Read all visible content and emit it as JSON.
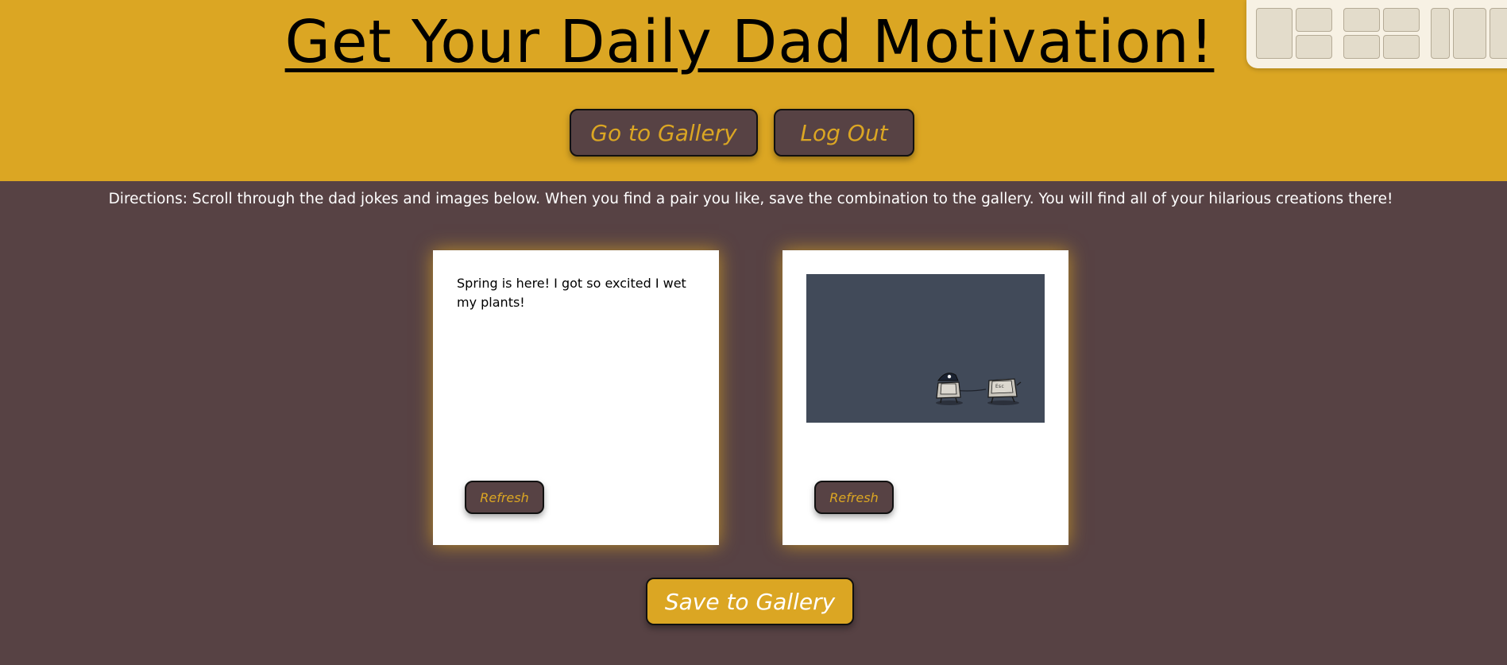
{
  "header": {
    "title": "Get Your Daily Dad Motivation!",
    "gallery_label": "Go to Gallery",
    "logout_label": "Log Out"
  },
  "directions": "Directions: Scroll through the dad jokes and images below. When you find a pair you like, save the combination to the gallery. You will find all of your hilarious creations there!",
  "joke_card": {
    "joke": "Spring is here! I got so excited I wet my plants!",
    "refresh_label": "Refresh"
  },
  "image_card": {
    "refresh_label": "Refresh",
    "image_icon": "comic-keycaps-icon"
  },
  "save_label": "Save to Gallery",
  "colors": {
    "accent": "#dba623",
    "background": "#574244",
    "card": "#ffffff",
    "comic_bg": "#414a59"
  }
}
